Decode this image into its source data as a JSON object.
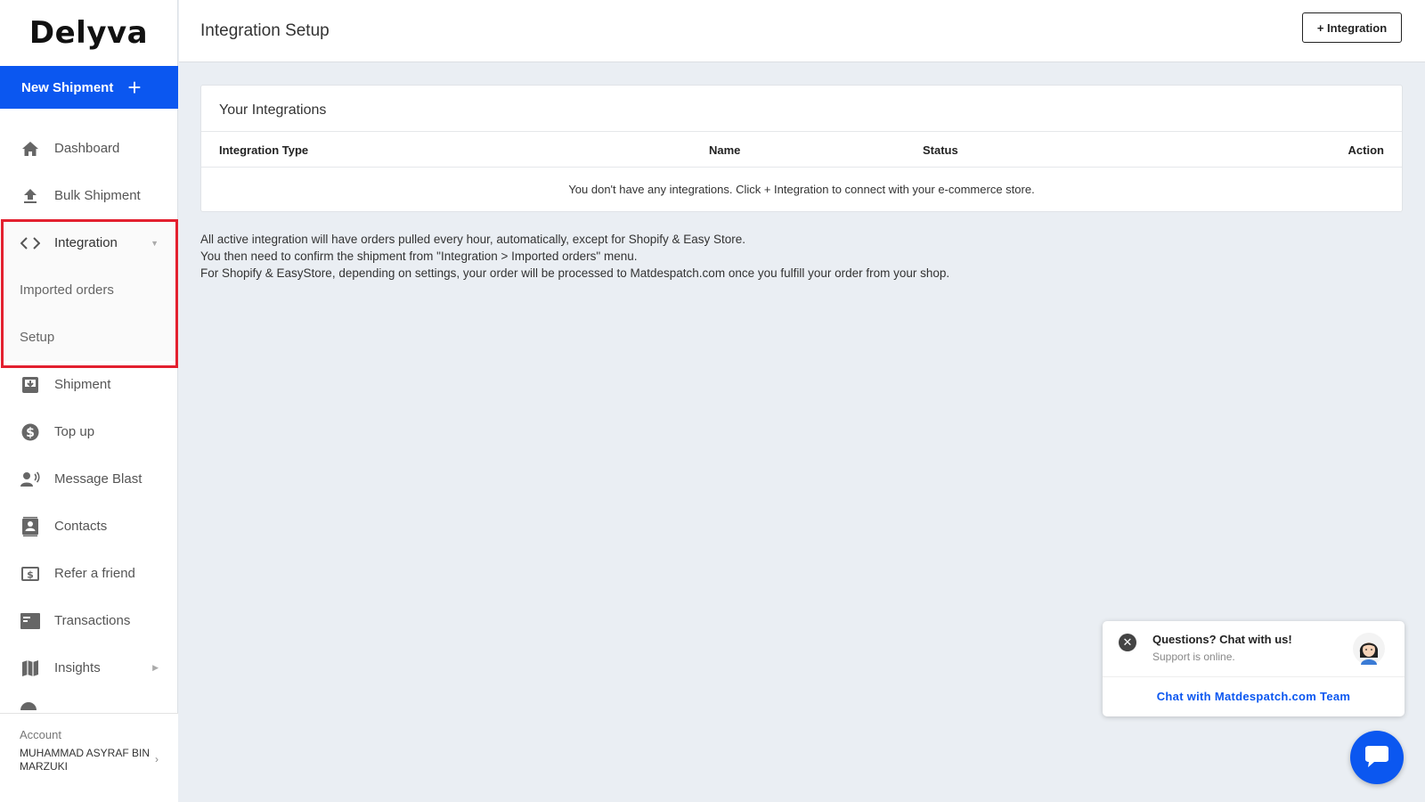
{
  "brand": {
    "logo_text": "Delyva",
    "accent_color": "#0b57f0",
    "highlight_color": "#e3202f"
  },
  "sidebar": {
    "new_shipment_label": "New Shipment",
    "items": [
      {
        "label": "Dashboard",
        "icon": "home-icon"
      },
      {
        "label": "Bulk Shipment",
        "icon": "upload-icon"
      },
      {
        "label": "Integration",
        "icon": "code-icon"
      },
      {
        "label": "Shipment",
        "icon": "inbox-icon"
      },
      {
        "label": "Top up",
        "icon": "dollar-icon"
      },
      {
        "label": "Message Blast",
        "icon": "broadcast-icon"
      },
      {
        "label": "Contacts",
        "icon": "contacts-icon"
      },
      {
        "label": "Refer a friend",
        "icon": "money-icon"
      },
      {
        "label": "Transactions",
        "icon": "card-icon"
      },
      {
        "label": "Insights",
        "icon": "map-icon"
      }
    ],
    "integration_sub": [
      "Imported orders",
      "Setup"
    ],
    "account_label": "Account",
    "account_name": "MUHAMMAD ASYRAF BIN MARZUKI"
  },
  "header": {
    "title": "Integration Setup",
    "add_button": "+ Integration"
  },
  "integrations": {
    "title": "Your Integrations",
    "columns": [
      "Integration Type",
      "Name",
      "Status",
      "Action"
    ],
    "empty_message": "You don't have any integrations. Click + Integration to connect with your e-commerce store."
  },
  "info": {
    "line1": "All active integration will have orders pulled every hour, automatically, except for Shopify & Easy Store.",
    "line2": "You then need to confirm the shipment from \"Integration > Imported orders\" menu.",
    "line3": "For Shopify & EasyStore, depending on settings, your order will be processed to Matdespatch.com once you fulfill your order from your shop."
  },
  "chat": {
    "question": "Questions? Chat with us!",
    "status": "Support is online.",
    "link": "Chat with Matdespatch.com Team"
  }
}
